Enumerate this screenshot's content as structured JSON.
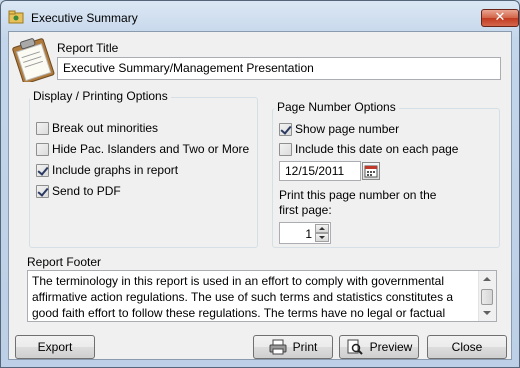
{
  "window": {
    "title": "Executive Summary"
  },
  "report_title": {
    "label": "Report Title",
    "value": "Executive Summary/Management Presentation"
  },
  "display_options": {
    "title": "Display / Printing Options",
    "items": [
      {
        "label": "Break out minorities",
        "checked": false
      },
      {
        "label": "Hide Pac. Islanders and Two or More",
        "checked": false
      },
      {
        "label": "Include graphs in report",
        "checked": true
      },
      {
        "label": "Send to PDF",
        "checked": true
      }
    ]
  },
  "page_number_options": {
    "title": "Page Number Options",
    "show_page_number": {
      "label": "Show page number",
      "checked": true
    },
    "include_date": {
      "label": "Include this date on each page",
      "checked": false
    },
    "date_value": "12/15/2011",
    "first_page_label_line1": "Print this page number on the",
    "first_page_label_line2": "first page:",
    "first_page_value": "1"
  },
  "report_footer": {
    "label": "Report Footer",
    "line1": "The terminology in this report is used in an effort to comply with governmental",
    "line2": "affirmative action regulations. The use of such terms and statistics constitutes a",
    "line3": "good faith effort to follow these regulations. The terms have no legal or factual"
  },
  "buttons": {
    "export": "Export",
    "print": "Print",
    "preview": "Preview",
    "close": "Close"
  },
  "icons": {
    "close_glyph": "✕",
    "app": "folder-icon",
    "header": "clipboard-icon",
    "calendar": "calendar-icon",
    "print": "printer-icon",
    "preview": "preview-icon"
  }
}
